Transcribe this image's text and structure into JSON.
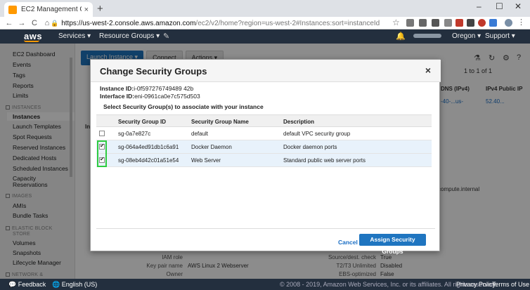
{
  "browser": {
    "tab_title": "EC2 Management Console",
    "tab_close": "×",
    "new_tab": "+",
    "url_lock": "🔒",
    "url_host": "https://us-west-2.console.aws.amazon.com",
    "url_path": "/ec2/v2/home?region=us-west-2#Instances:sort=instanceId",
    "win_min": "–",
    "win_max": "☐",
    "win_close": "✕",
    "back": "←",
    "forward": "→",
    "reload": "C",
    "home": "⌂",
    "star": "☆"
  },
  "awsnav": {
    "logo": "aws",
    "services": "Services ▾",
    "resource_groups": "Resource Groups ▾",
    "pin": "✎",
    "bell": "🔔",
    "region": "Oregon ▾",
    "support": "Support ▾"
  },
  "sidebar": {
    "ec2_dashboard": "EC2 Dashboard",
    "events": "Events",
    "tags": "Tags",
    "reports": "Reports",
    "limits": "Limits",
    "instances_head": "INSTANCES",
    "instances": "Instances",
    "launch_templates": "Launch Templates",
    "spot_requests": "Spot Requests",
    "reserved_instances": "Reserved Instances",
    "dedicated_hosts": "Dedicated Hosts",
    "scheduled_instances": "Scheduled Instances",
    "capacity_reservations_1": "Capacity",
    "capacity_reservations_2": "Reservations",
    "images_head": "IMAGES",
    "amis": "AMIs",
    "bundle_tasks": "Bundle Tasks",
    "ebs_head_1": "ELASTIC BLOCK",
    "ebs_head_2": "STORE",
    "volumes": "Volumes",
    "snapshots": "Snapshots",
    "lifecycle_manager": "Lifecycle Manager",
    "network_head": "NETWORK &"
  },
  "main": {
    "launch_instance": "Launch Instance ▾",
    "connect": "Connect",
    "actions": "Actions ▾",
    "pager": "1 to 1 of 1",
    "col_dns": "DNS (IPv4)",
    "col_ipv4": "IPv4 Public IP",
    "dns_value": "-40-...us-",
    "ip_value": "52.40...",
    "compute_internal": "compute.internal",
    "iam_role_label": "IAM role",
    "keypair_label": "Key pair name",
    "keypair_value": "AWS Linux 2 Webserver",
    "owner_label": "Owner",
    "srcdest_label": "Source/dest. check",
    "srcdest_value": "True",
    "t2t3_label": "T2/T3 Unlimited",
    "t2t3_value": "Disabled",
    "ebs_opt_label": "EBS-optimized",
    "ebs_opt_value": "False",
    "in_label": "In"
  },
  "modal": {
    "title": "Change Security Groups",
    "close": "×",
    "instance_id_label": "Instance ID:",
    "instance_id": "i-0f597276749489 42b",
    "interface_id_label": "Interface ID:",
    "interface_id": "eni-0961ca0e7c575d503",
    "instruction": "Select Security Group(s) to associate with your instance",
    "columns": {
      "id": "Security Group ID",
      "name": "Security Group Name",
      "desc": "Description"
    },
    "rows": [
      {
        "id": "sg-0a7e827c",
        "name": "default",
        "desc": "default VPC security group",
        "checked": false
      },
      {
        "id": "sg-064a4ed91db1c6a91",
        "name": "Docker Daemon",
        "desc": "Docker daemon ports",
        "checked": true
      },
      {
        "id": "sg-08eb4d42c01a51e54",
        "name": "Web Server",
        "desc": "Standard public web server ports",
        "checked": true
      }
    ],
    "cancel": "Cancel",
    "assign": "Assign Security Groups"
  },
  "footer": {
    "feedback": "Feedback",
    "language": "English (US)",
    "copyright": "© 2008 - 2019, Amazon Web Services, Inc. or its affiliates. All rights reserved.",
    "privacy": "Privacy Policy",
    "terms": "Terms of Use"
  },
  "colors": {
    "aws_nav": "#232f3e",
    "aws_orange": "#ff9900",
    "primary_blue": "#1f75c0",
    "highlight_green": "#2ecc40"
  }
}
